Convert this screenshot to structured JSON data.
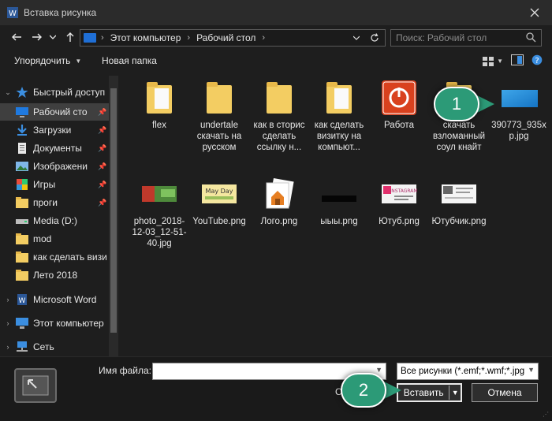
{
  "window": {
    "title": "Вставка рисунка",
    "icons": {
      "app": "word-icon",
      "close": "close-icon"
    }
  },
  "navigation": {
    "back_icon": "arrow-left-icon",
    "forward_icon": "arrow-right-icon",
    "recent_icon": "chevron-down-icon",
    "up_icon": "arrow-up-icon",
    "address": {
      "crumbs": [
        "Этот компьютер",
        "Рабочий стол"
      ]
    },
    "refresh_icon": "refresh-icon",
    "search": {
      "placeholder": "Поиск: Рабочий стол",
      "value": ""
    }
  },
  "commands": {
    "organize_label": "Упорядочить",
    "new_folder_label": "Новая папка",
    "view_icon": "view-mode-icon",
    "preview_pane_icon": "preview-pane-icon",
    "help_icon": "help-icon"
  },
  "sidebar": {
    "items": [
      {
        "label": "Быстрый доступ",
        "icon": "star-icon",
        "expander": "expanded",
        "pinned": false,
        "selected": false
      },
      {
        "label": "Рабочий сто",
        "icon": "desktop-icon",
        "expander": "",
        "pinned": true,
        "selected": true
      },
      {
        "label": "Загрузки",
        "icon": "download-icon",
        "expander": "",
        "pinned": true,
        "selected": false
      },
      {
        "label": "Документы",
        "icon": "documents-icon",
        "expander": "",
        "pinned": true,
        "selected": false
      },
      {
        "label": "Изображени",
        "icon": "pictures-icon",
        "expander": "",
        "pinned": true,
        "selected": false
      },
      {
        "label": "Игры",
        "icon": "games-icon",
        "expander": "",
        "pinned": true,
        "selected": false
      },
      {
        "label": "проги",
        "icon": "folder-icon",
        "expander": "",
        "pinned": true,
        "selected": false
      },
      {
        "label": "Media (D:)",
        "icon": "drive-icon",
        "expander": "",
        "pinned": false,
        "selected": false
      },
      {
        "label": "mod",
        "icon": "folder-icon",
        "expander": "",
        "pinned": false,
        "selected": false
      },
      {
        "label": "как сделать визи",
        "icon": "folder-icon",
        "expander": "",
        "pinned": false,
        "selected": false
      },
      {
        "label": "Лето 2018",
        "icon": "folder-icon",
        "expander": "",
        "pinned": false,
        "selected": false
      },
      {
        "label": "Microsoft Word",
        "icon": "word-icon",
        "expander": "collapsed",
        "pinned": false,
        "selected": false
      },
      {
        "label": "Этот компьютер",
        "icon": "computer-icon",
        "expander": "collapsed",
        "pinned": false,
        "selected": false
      },
      {
        "label": "Сеть",
        "icon": "network-icon",
        "expander": "collapsed",
        "pinned": false,
        "selected": false
      }
    ]
  },
  "files": [
    {
      "name": "flex",
      "kind": "folder",
      "icon": "folder-icon"
    },
    {
      "name": "undertale скачать на русском",
      "kind": "folder",
      "icon": "folder-icon"
    },
    {
      "name": "как в сторис сделать ссылку н...",
      "kind": "folder",
      "icon": "folder-icon"
    },
    {
      "name": "как сделать визитку на компьют...",
      "kind": "folder",
      "icon": "folder-icon"
    },
    {
      "name": "Работа",
      "kind": "shortcut",
      "icon": "power-app-icon"
    },
    {
      "name": "скачать взломанный соул кнайт",
      "kind": "folder",
      "icon": "folder-icon"
    },
    {
      "name": "390773_935xp.jpg",
      "kind": "image",
      "icon": "image-thumbnail-blue"
    },
    {
      "name": "photo_2018-12-03_12-51-40.jpg",
      "kind": "image",
      "icon": "image-thumbnail-photo"
    },
    {
      "name": "YouTube.png",
      "kind": "image",
      "icon": "image-thumbnail-youtube"
    },
    {
      "name": "Лого.png",
      "kind": "image",
      "icon": "image-thumbnail-logo"
    },
    {
      "name": "ыыы.png",
      "kind": "image",
      "icon": "image-thumbnail-black"
    },
    {
      "name": "Ютуб.png",
      "kind": "image",
      "icon": "image-thumbnail-instagram"
    },
    {
      "name": "Ютубчик.png",
      "kind": "image",
      "icon": "image-thumbnail-doc"
    }
  ],
  "footer": {
    "filename_label": "Имя файла:",
    "filename_value": "",
    "filetype_value": "Все рисунки (*.emf;*.wmf;*.jpg",
    "tools_label": "С",
    "insert_label": "Вставить",
    "cancel_label": "Отмена",
    "preview_icon": "picture-frame-icon"
  },
  "annotations": {
    "badge1": "1",
    "badge2": "2"
  },
  "colors": {
    "accent": "#1f6fd6",
    "badge": "#2c9a77",
    "folder": "#f3cd62",
    "background": "#1e1e1e"
  }
}
